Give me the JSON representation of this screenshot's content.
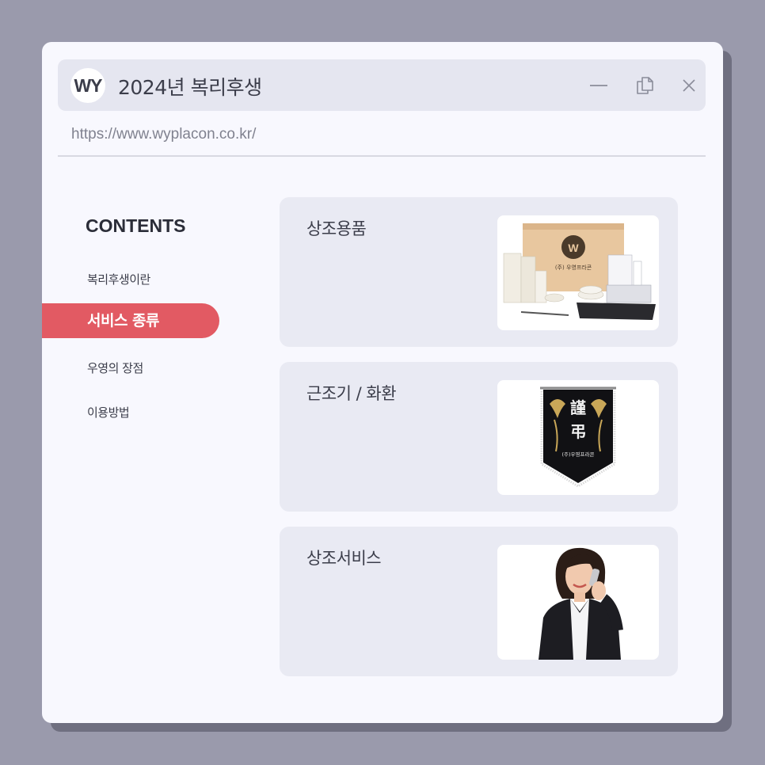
{
  "window": {
    "logo_text": "WY",
    "title": "2024년 복리후생",
    "url": "https://www.wyplacon.co.kr/"
  },
  "sidebar": {
    "heading": "CONTENTS",
    "items": [
      {
        "label": "복리후생이란",
        "active": false
      },
      {
        "label": "서비스 종류",
        "active": true
      },
      {
        "label": "우영의 장점",
        "active": false
      },
      {
        "label": "이용방법",
        "active": false
      }
    ]
  },
  "cards": [
    {
      "title": "상조용품",
      "image": "funeral-supplies-photo",
      "brand_text": "(주) 우영프라콘"
    },
    {
      "title": "근조기 / 화환",
      "image": "condolence-flag-photo",
      "flag_chars": [
        "謹",
        "弔"
      ],
      "brand_text": "(주)우영프라콘"
    },
    {
      "title": "상조서비스",
      "image": "call-agent-photo"
    }
  ],
  "colors": {
    "background": "#9a9aac",
    "window": "#f8f8fe",
    "titlebar": "#e5e6f0",
    "card": "#e9eaf3",
    "accent": "#e25a63"
  },
  "icons": [
    "minimize-icon",
    "copy-icon",
    "close-icon"
  ]
}
